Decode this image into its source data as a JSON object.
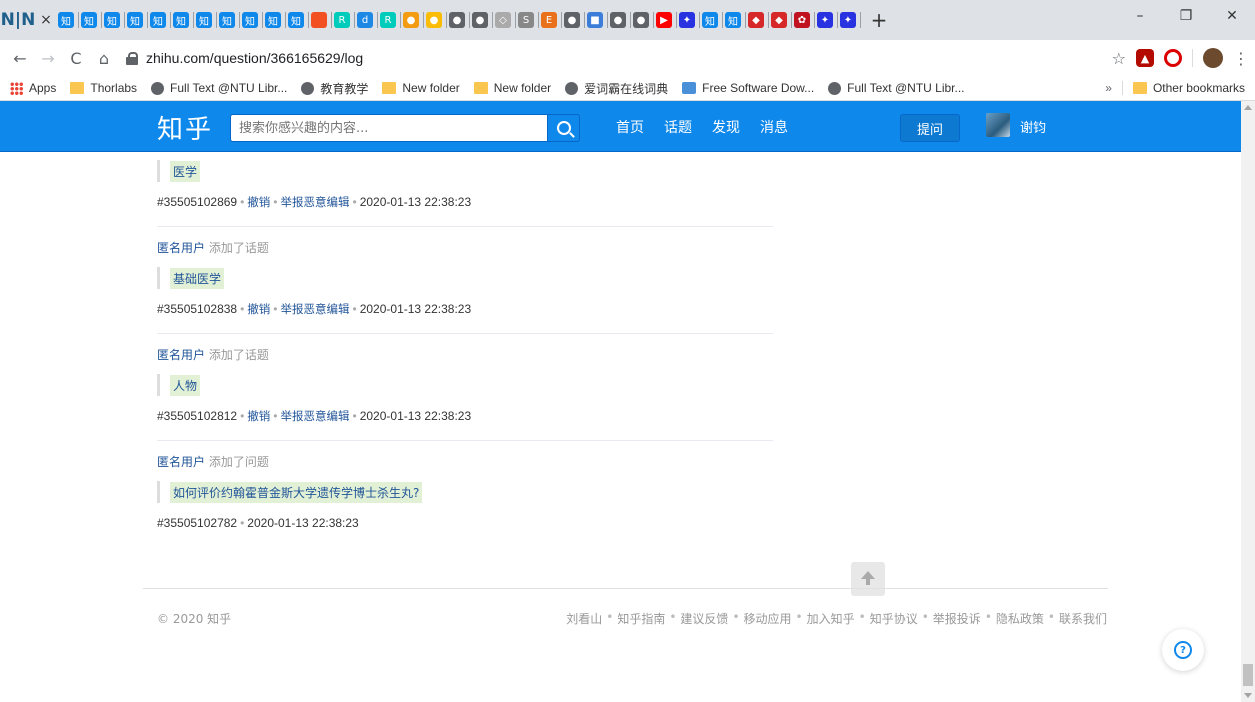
{
  "browser": {
    "tabstrip_logo": "N|N",
    "tab_close": "×",
    "tab_favicons": [
      {
        "name": "zhihu",
        "color": "#0f88eb",
        "glyph": "知"
      },
      {
        "name": "zhihu",
        "color": "#0f88eb",
        "glyph": "知"
      },
      {
        "name": "zhihu",
        "color": "#0f88eb",
        "glyph": "知"
      },
      {
        "name": "zhihu",
        "color": "#0f88eb",
        "glyph": "知"
      },
      {
        "name": "zhihu",
        "color": "#0f88eb",
        "glyph": "知"
      },
      {
        "name": "zhihu",
        "color": "#0f88eb",
        "glyph": "知"
      },
      {
        "name": "zhihu",
        "color": "#0f88eb",
        "glyph": "知"
      },
      {
        "name": "zhihu",
        "color": "#0f88eb",
        "glyph": "知"
      },
      {
        "name": "zhihu",
        "color": "#0f88eb",
        "glyph": "知"
      },
      {
        "name": "zhihu",
        "color": "#0f88eb",
        "glyph": "知"
      },
      {
        "name": "zhihu",
        "color": "#0f88eb",
        "glyph": "知"
      },
      {
        "name": "microsoft",
        "color": "#f25022",
        "glyph": ""
      },
      {
        "name": "researchgate",
        "color": "#00ccbb",
        "glyph": "R"
      },
      {
        "name": "dict",
        "color": "#1e88e5",
        "glyph": "d"
      },
      {
        "name": "researchgate",
        "color": "#00ccbb",
        "glyph": "R"
      },
      {
        "name": "orange",
        "color": "#f39c12",
        "glyph": "●"
      },
      {
        "name": "chrome-like",
        "color": "#fbbc05",
        "glyph": "●"
      },
      {
        "name": "globe",
        "color": "#5f6368",
        "glyph": "●"
      },
      {
        "name": "globe",
        "color": "#5f6368",
        "glyph": "●"
      },
      {
        "name": "share",
        "color": "#aaaaaa",
        "glyph": "◇"
      },
      {
        "name": "s",
        "color": "#888888",
        "glyph": "S"
      },
      {
        "name": "elsevier",
        "color": "#e9711c",
        "glyph": "E"
      },
      {
        "name": "globe",
        "color": "#5f6368",
        "glyph": "●"
      },
      {
        "name": "img",
        "color": "#3b7dd8",
        "glyph": "■"
      },
      {
        "name": "globe",
        "color": "#5f6368",
        "glyph": "●"
      },
      {
        "name": "globe",
        "color": "#5f6368",
        "glyph": "●"
      },
      {
        "name": "youtube",
        "color": "#ff0000",
        "glyph": "▶"
      },
      {
        "name": "baidu",
        "color": "#2932e1",
        "glyph": "✦"
      },
      {
        "name": "zhihu",
        "color": "#0f88eb",
        "glyph": "知"
      },
      {
        "name": "zhihu",
        "color": "#0f88eb",
        "glyph": "知"
      },
      {
        "name": "red",
        "color": "#d62828",
        "glyph": "◆"
      },
      {
        "name": "red",
        "color": "#d62828",
        "glyph": "◆"
      },
      {
        "name": "red2",
        "color": "#c1121f",
        "glyph": "✿"
      },
      {
        "name": "baidu",
        "color": "#2932e1",
        "glyph": "✦"
      },
      {
        "name": "baidu",
        "color": "#2932e1",
        "glyph": "✦"
      }
    ],
    "new_tab": "+",
    "window_controls": {
      "minimize": "–",
      "restore": "❐",
      "close": "✕"
    },
    "nav": {
      "back": "←",
      "forward": "→",
      "reload": "C",
      "home": "⌂"
    },
    "url": "zhihu.com/question/366165629/log",
    "star": "☆",
    "bookmarks": [
      {
        "label": "Apps",
        "icon": "apps-grid"
      },
      {
        "label": "Thorlabs",
        "icon": "folder"
      },
      {
        "label": "Full Text @NTU Libr...",
        "icon": "globe"
      },
      {
        "label": "教育教学",
        "icon": "globe"
      },
      {
        "label": "New folder",
        "icon": "folder"
      },
      {
        "label": "New folder",
        "icon": "folder"
      },
      {
        "label": "爱词霸在线词典",
        "icon": "globe"
      },
      {
        "label": "Free Software Dow...",
        "icon": "download"
      },
      {
        "label": "Full Text @NTU Libr...",
        "icon": "globe"
      }
    ],
    "bookmarks_more": "»",
    "other_bookmarks": "Other bookmarks"
  },
  "zhihu": {
    "logo": "知乎",
    "search_placeholder": "搜索你感兴趣的内容...",
    "nav": [
      "首页",
      "话题",
      "发现",
      "消息"
    ],
    "ask": "提问",
    "user": "谢钧",
    "brand_color": "#0f88eb"
  },
  "logs": [
    {
      "actor": "",
      "action": "",
      "quote": "医学",
      "highlight": true,
      "id": "#35505102869",
      "links": [
        "撤销",
        "举报恶意编辑"
      ],
      "time": "2020-01-13 22:38:23"
    },
    {
      "actor": "匿名用户",
      "action": "添加了话题",
      "quote": "基础医学",
      "highlight": true,
      "id": "#35505102838",
      "links": [
        "撤销",
        "举报恶意编辑"
      ],
      "time": "2020-01-13 22:38:23"
    },
    {
      "actor": "匿名用户",
      "action": "添加了话题",
      "quote": "人物",
      "highlight": true,
      "id": "#35505102812",
      "links": [
        "撤销",
        "举报恶意编辑"
      ],
      "time": "2020-01-13 22:38:23"
    },
    {
      "actor": "匿名用户",
      "action": "添加了问题",
      "quote": "如何评价约翰霍普金斯大学遗传学博士杀生丸?",
      "highlight": true,
      "id": "#35505102782",
      "links": [],
      "time": "2020-01-13 22:38:23"
    }
  ],
  "footer": {
    "copyright": "© 2020 知乎",
    "links": [
      "刘看山",
      "知乎指南",
      "建议反馈",
      "移动应用",
      "加入知乎",
      "知乎协议",
      "举报投诉",
      "隐私政策",
      "联系我们"
    ]
  }
}
